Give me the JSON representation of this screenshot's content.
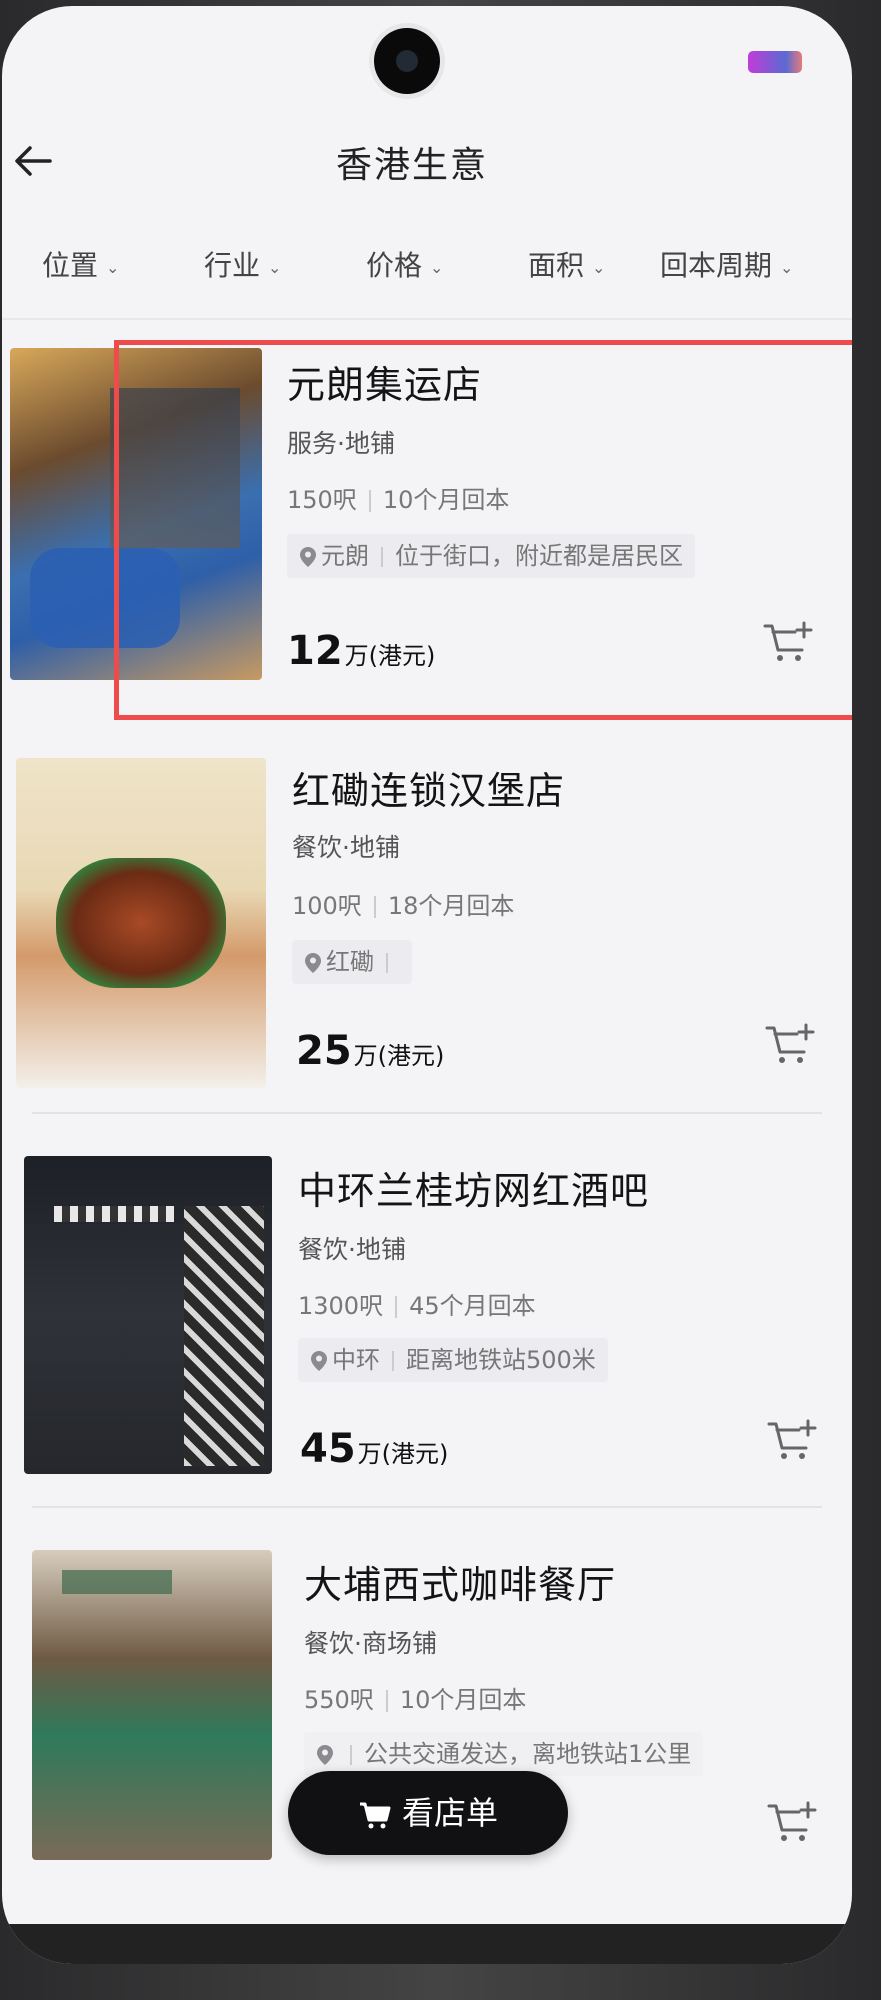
{
  "header": {
    "title": "香港生意"
  },
  "filters": [
    {
      "label": "位置"
    },
    {
      "label": "行业"
    },
    {
      "label": "价格"
    },
    {
      "label": "面积"
    },
    {
      "label": "回本周期"
    }
  ],
  "listings": [
    {
      "title": "元朗集运店",
      "category": "服务·地铺",
      "area": "150呎",
      "payback": "10个月回本",
      "district": "元朗",
      "note": "位于街口，附近都是居民区",
      "price": "12",
      "price_unit": "万(港元)"
    },
    {
      "title": "红磡连锁汉堡店",
      "category": "餐饮·地铺",
      "area": "100呎",
      "payback": "18个月回本",
      "district": "红磡",
      "note": "",
      "price": "25",
      "price_unit": "万(港元)"
    },
    {
      "title": "中环兰桂坊网红酒吧",
      "category": "餐饮·地铺",
      "area": "1300呎",
      "payback": "45个月回本",
      "district": "中环",
      "note": "距离地铁站500米",
      "price": "45",
      "price_unit": "万(港元)"
    },
    {
      "title": "大埔西式咖啡餐厅",
      "category": "餐饮·商场铺",
      "area": "550呎",
      "payback": "10个月回本",
      "district": "",
      "note": "公共交通发达，离地铁站1公里"
    }
  ],
  "floating_button": {
    "label": "看店单"
  },
  "colors": {
    "highlight": "#ee4c4c",
    "accent": "#111114"
  }
}
